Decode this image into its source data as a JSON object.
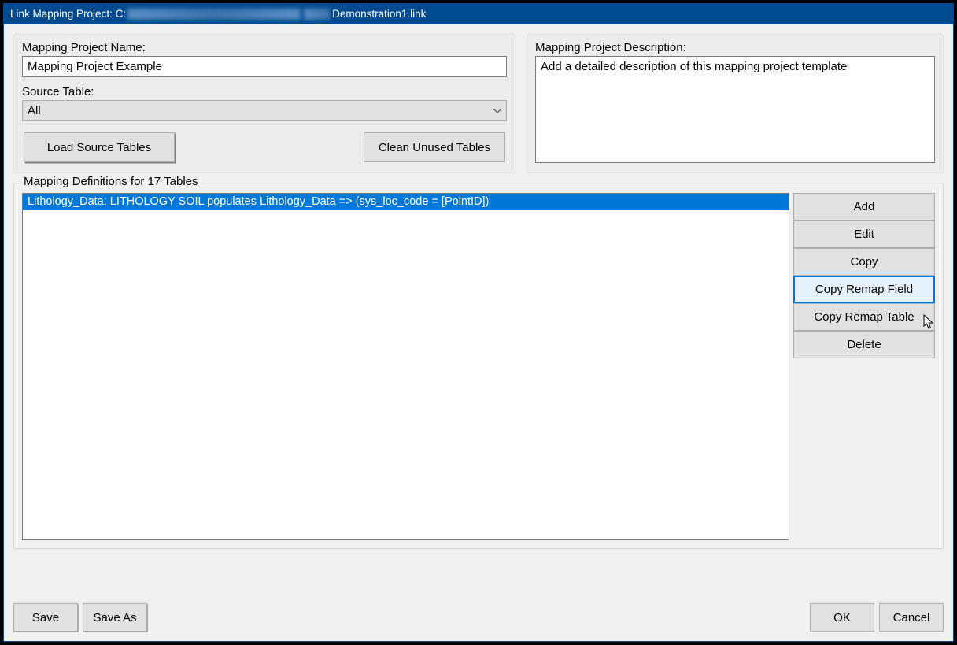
{
  "titlebar": {
    "prefix": "Link Mapping Project: C:",
    "suffix": "Demonstration1.link"
  },
  "left_panel": {
    "name_label": "Mapping Project Name:",
    "name_value": "Mapping Project Example",
    "source_label": "Source Table:",
    "source_selected": "All",
    "load_btn": "Load Source Tables",
    "clean_btn": "Clean Unused Tables"
  },
  "right_panel": {
    "desc_label": "Mapping Project Description:",
    "desc_value": "Add a detailed description of this mapping project template"
  },
  "definitions": {
    "legend": "Mapping Definitions for 17 Tables",
    "items": [
      "Lithology_Data: LITHOLOGY SOIL populates Lithology_Data => (sys_loc_code = [PointID])"
    ],
    "buttons": {
      "add": "Add",
      "edit": "Edit",
      "copy": "Copy",
      "copy_remap_field": "Copy Remap Field",
      "copy_remap_table": "Copy Remap Table",
      "delete": "Delete"
    }
  },
  "bottom": {
    "save": "Save",
    "save_as": "Save As",
    "ok": "OK",
    "cancel": "Cancel"
  }
}
